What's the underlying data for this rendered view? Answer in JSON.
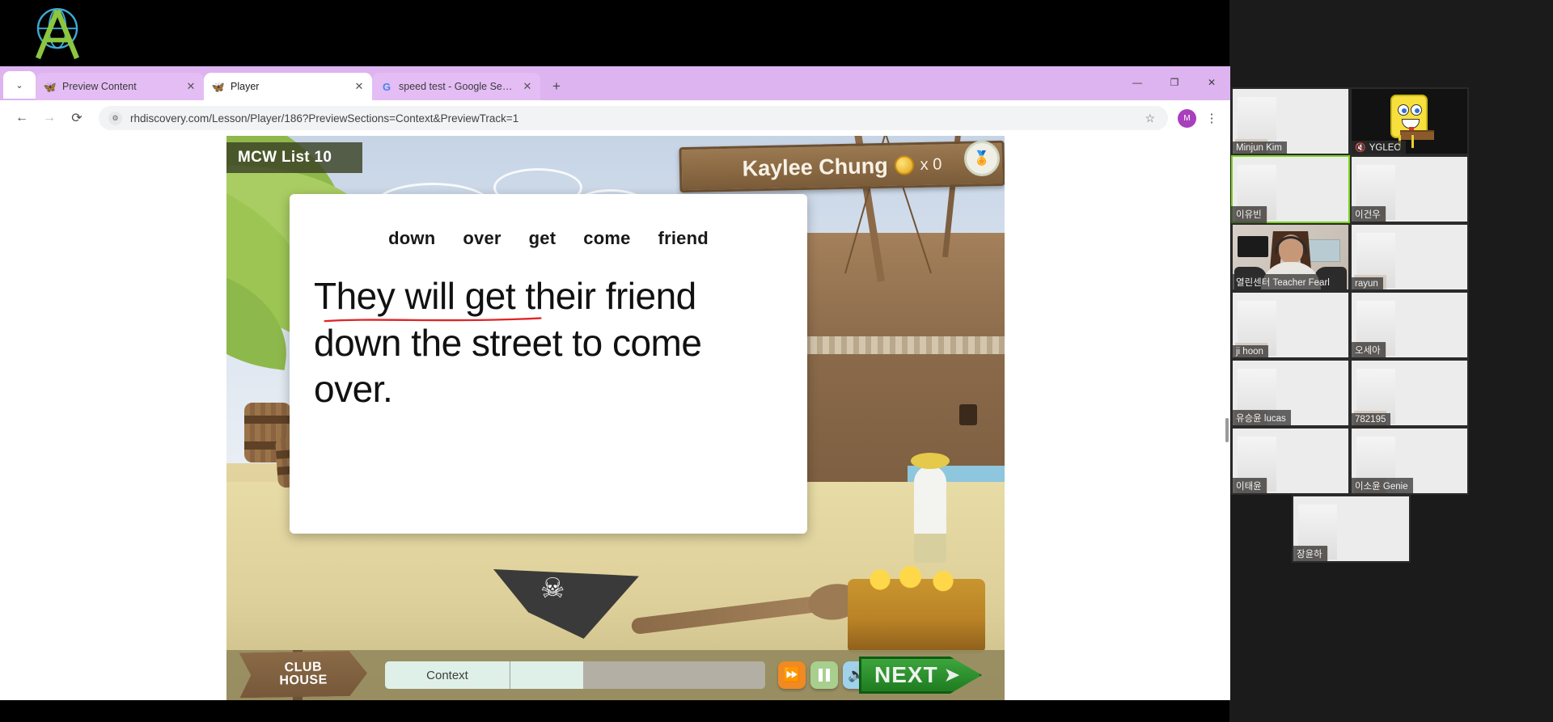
{
  "browser": {
    "tabs": [
      {
        "title": "Preview Content",
        "favicon": "butterfly-icon",
        "active": false
      },
      {
        "title": "Player",
        "favicon": "butterfly-icon",
        "active": true
      },
      {
        "title": "speed test - Google Search",
        "favicon": "google-icon",
        "active": false
      }
    ],
    "new_tab_label": "+",
    "tab_list_chevron": "⌄",
    "window_controls": {
      "minimize": "—",
      "maximize": "❐",
      "close": "✕"
    },
    "nav": {
      "back": "←",
      "forward": "→",
      "reload": "⟳"
    },
    "url": "rhdiscovery.com/Lesson/Player/186?PreviewSections=Context&PreviewTrack=1",
    "site_info_icon": "site-settings-icon",
    "bookmark_icon": "☆",
    "profile_initial": "M",
    "menu_icon": "⋮"
  },
  "lesson": {
    "list_title": "MCW List 10",
    "student_name": "Kaylee Chung",
    "coin_multiplier": "x 0",
    "badge_icon": "🏅",
    "word_list": [
      "down",
      "over",
      "get",
      "come",
      "friend"
    ],
    "sentence_lines": [
      "They will get their friend",
      "down the street to come",
      "over."
    ],
    "annotation_color": "#e02424",
    "clubhouse_line1": "CLUB",
    "clubhouse_line2": "HOUSE",
    "section_label": "Context",
    "controls": {
      "speed_label": "skip-icon",
      "pause_label": "pause-icon",
      "sound_label": "sound-icon"
    },
    "next_label": "NEXT",
    "next_arrow": "➡"
  },
  "video_panel": {
    "participants": [
      {
        "name": "Minjun Kim",
        "muted": false,
        "active": false,
        "avatar": "none",
        "video": "blurred"
      },
      {
        "name": "YGLEC",
        "muted": true,
        "active": false,
        "avatar": "spongebob",
        "video": "off"
      },
      {
        "name": "이유빈",
        "muted": false,
        "active": true,
        "avatar": "none",
        "video": "blurred"
      },
      {
        "name": "이건우",
        "muted": false,
        "active": false,
        "avatar": "none",
        "video": "blurred"
      },
      {
        "name": "열린센터 Teacher Fearl",
        "muted": false,
        "active": false,
        "avatar": "none",
        "video": "teacher"
      },
      {
        "name": "rayun",
        "muted": false,
        "active": false,
        "avatar": "none",
        "video": "blurred"
      },
      {
        "name": "ji hoon",
        "muted": false,
        "active": false,
        "avatar": "none",
        "video": "blurred"
      },
      {
        "name": "오세아",
        "muted": false,
        "active": false,
        "avatar": "none",
        "video": "blurred"
      },
      {
        "name": "유승윤 lucas",
        "muted": false,
        "active": false,
        "avatar": "none",
        "video": "blurred"
      },
      {
        "name": "782195",
        "muted": false,
        "active": false,
        "avatar": "none",
        "video": "blurred"
      },
      {
        "name": "이태윤",
        "muted": false,
        "active": false,
        "avatar": "none",
        "video": "blurred"
      },
      {
        "name": "이소윤 Genie",
        "muted": false,
        "active": false,
        "avatar": "none",
        "video": "blurred"
      },
      {
        "name": "장윤하",
        "muted": false,
        "active": false,
        "avatar": "none",
        "video": "blurred"
      }
    ]
  },
  "colors": {
    "tab_strip": "#ddb3f0",
    "active_speaker": "#7ed321",
    "next_button": "#1f7d20",
    "mute_red": "#e8403a"
  }
}
